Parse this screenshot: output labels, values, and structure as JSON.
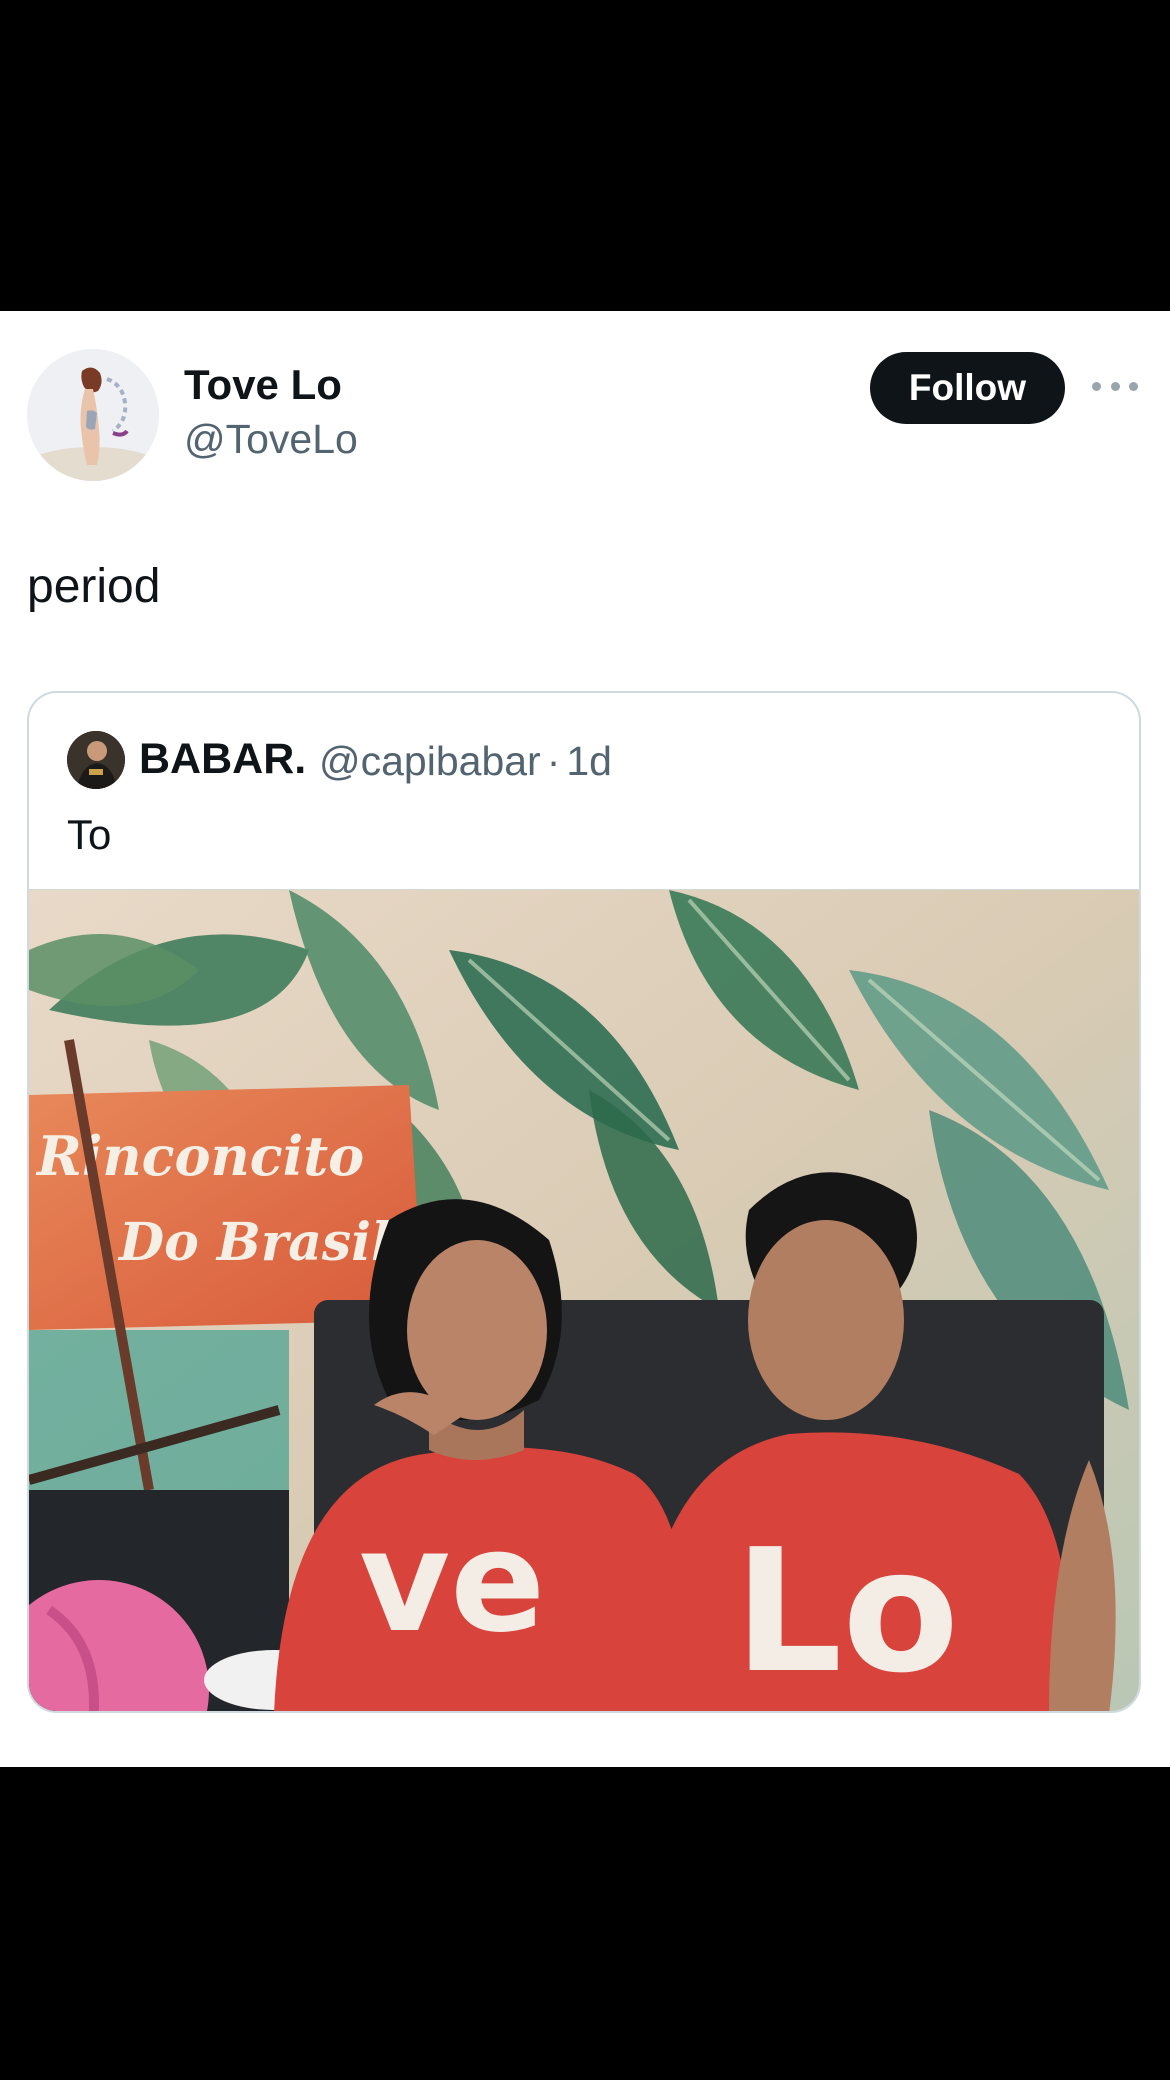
{
  "tweet": {
    "author": {
      "display_name": "Tove Lo",
      "handle": "@ToveLo"
    },
    "follow_label": "Follow",
    "more_icon": "ellipsis-icon",
    "text": "period"
  },
  "quoted_tweet": {
    "author": {
      "display_name": "BABAR.",
      "handle": "@capibabar",
      "separator": "·",
      "time": "1d"
    },
    "text": "To",
    "media": {
      "sign_line1": "Rinconcito",
      "sign_line2": "Do Brasil",
      "shirt_left": "ve",
      "shirt_right": "Lo"
    }
  },
  "colors": {
    "background": "#ffffff",
    "text_primary": "#0f1419",
    "text_secondary": "#536471",
    "follow_bg": "#0f1419",
    "border": "#cfd9de",
    "shirt_red": "#d8433c"
  }
}
